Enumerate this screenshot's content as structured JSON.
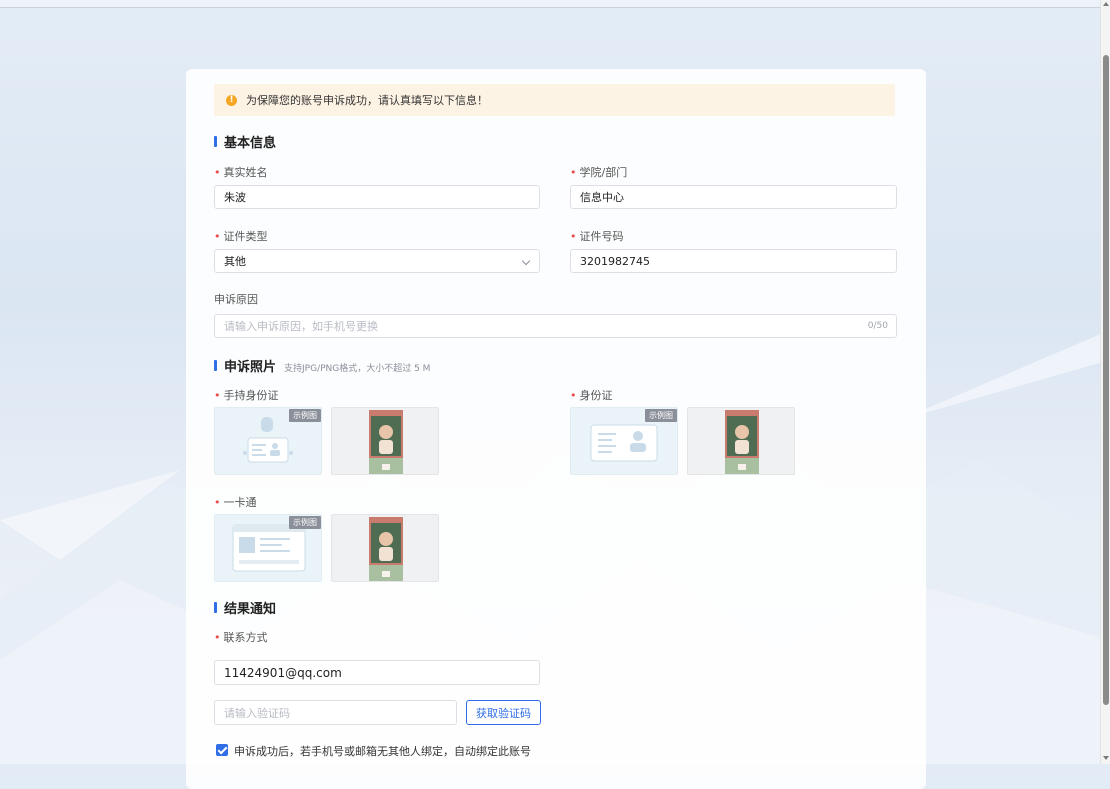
{
  "notice": {
    "icon": "exclamation-icon",
    "text": "为保障您的账号申诉成功，请认真填写以下信息！"
  },
  "basic": {
    "title": "基本信息",
    "name": {
      "label": "真实姓名",
      "value": "朱波"
    },
    "department": {
      "label": "学院/部门",
      "value": "信息中心"
    },
    "id_type": {
      "label": "证件类型",
      "value": "其他"
    },
    "id_number": {
      "label": "证件号码",
      "value": "3201982745"
    },
    "reason": {
      "label": "申诉原因",
      "placeholder": "请输入申诉原因，如手机号更换",
      "counter": "0/50"
    }
  },
  "photos": {
    "title": "申诉照片",
    "hint": "支持JPG/PNG格式，大小不超过 5 M",
    "sample_tag": "示例图",
    "handheld": {
      "label": "手持身份证"
    },
    "id_card": {
      "label": "身份证"
    },
    "campus_card": {
      "label": "一卡通"
    }
  },
  "result": {
    "title": "结果通知",
    "contact": {
      "label": "联系方式",
      "value": "11424901@qq.com"
    },
    "code": {
      "placeholder": "请输入验证码",
      "button": "获取验证码"
    },
    "agree": {
      "checked": true,
      "text": "申诉成功后，若手机号或邮箱无其他人绑定，自动绑定此账号"
    }
  },
  "colors": {
    "primary": "#2f6ee6",
    "required": "#e84a4a",
    "notice_bg": "#fdf3e4",
    "notice_icon": "#f5a623"
  }
}
